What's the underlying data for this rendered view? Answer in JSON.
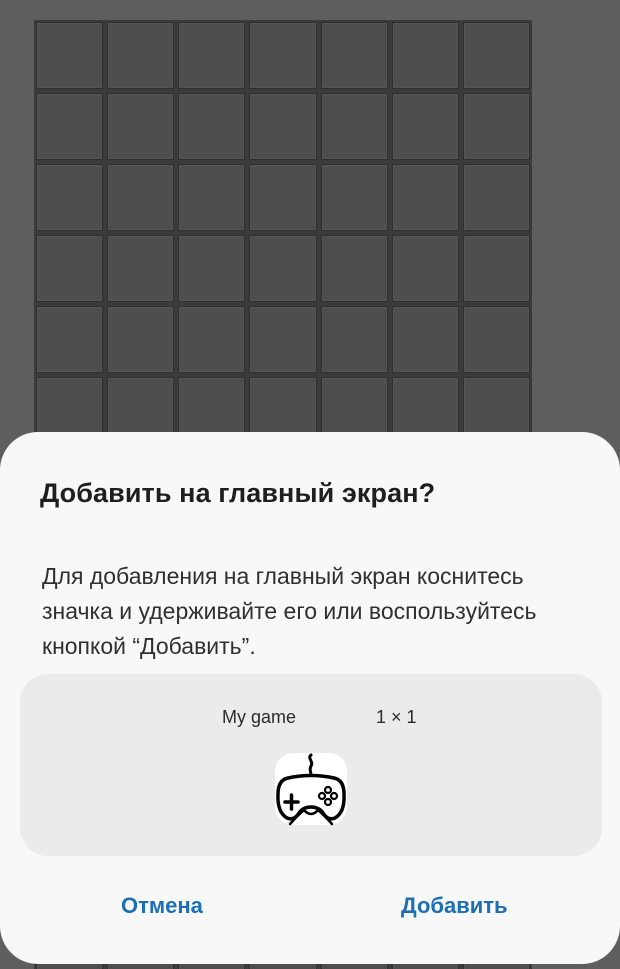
{
  "background": {
    "board_rows": 14,
    "board_cols": 7
  },
  "dialog": {
    "title": "Добавить на главный экран?",
    "message": "Для добавления на главный экран коснитесь значка и удерживайте его или воспользуйтесь кнопкой “Добавить”.",
    "preview": {
      "widget_name": "My game",
      "widget_size": "1 × 1",
      "icon": "gamepad-icon"
    },
    "buttons": {
      "cancel_label": "Отмена",
      "add_label": "Добавить"
    }
  },
  "colors": {
    "accent": "#1c6fb4",
    "sheet_background": "#f8f8f8",
    "card_background": "#ebebeb",
    "board_tile": "#4e4e4e",
    "backdrop": "#5e5e5e"
  }
}
